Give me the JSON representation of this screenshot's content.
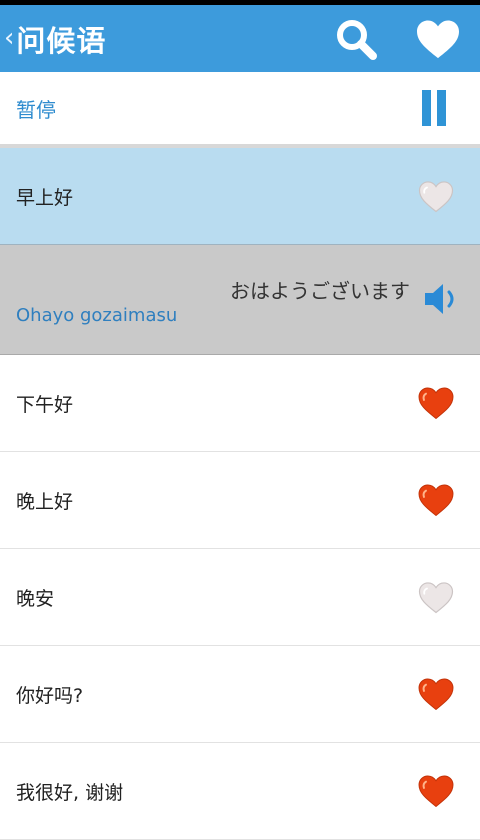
{
  "header": {
    "back_glyph": "‹",
    "title": "问候语",
    "icons": {
      "search": "search-icon",
      "favorite": "heart-icon"
    }
  },
  "player": {
    "pause_label": "暂停",
    "pause_icon": "pause-icon"
  },
  "phrases": [
    {
      "text": "早上好",
      "favorite": false,
      "selected": true
    },
    {
      "text": "下午好",
      "favorite": true
    },
    {
      "text": "晚上好",
      "favorite": true
    },
    {
      "text": "晚安",
      "favorite": false
    },
    {
      "text": "你好吗?",
      "favorite": true
    },
    {
      "text": "我很好, 谢谢",
      "favorite": true
    }
  ],
  "detail": {
    "japanese": "おはようございます",
    "romaji": "Ohayo gozaimasu",
    "icon": "speaker-icon"
  },
  "colors": {
    "appbar": "#3d9bdc",
    "accent": "#2f94d6",
    "selected_row": "#b9dcf0",
    "detail_panel": "#c9c9c9",
    "heart_on": "#e8400f",
    "heart_off": "#e6e0e0"
  }
}
